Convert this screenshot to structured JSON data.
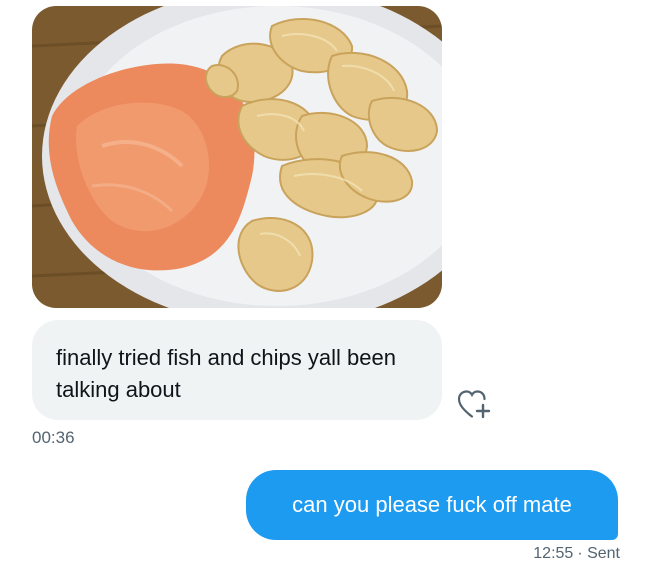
{
  "conversation": {
    "received": {
      "image_alt": "plate of smoked salmon and potato chips",
      "text": "finally tried fish and chips yall been talking about",
      "time": "00:36",
      "reaction_icon": "heart-plus-icon"
    },
    "sent": {
      "text": "can you please fuck off mate",
      "time": "12:55",
      "status": "· Sent"
    }
  },
  "colors": {
    "sent_bubble": "#1d9bf0",
    "received_bubble": "#eff3f4",
    "meta_text": "#536471"
  }
}
